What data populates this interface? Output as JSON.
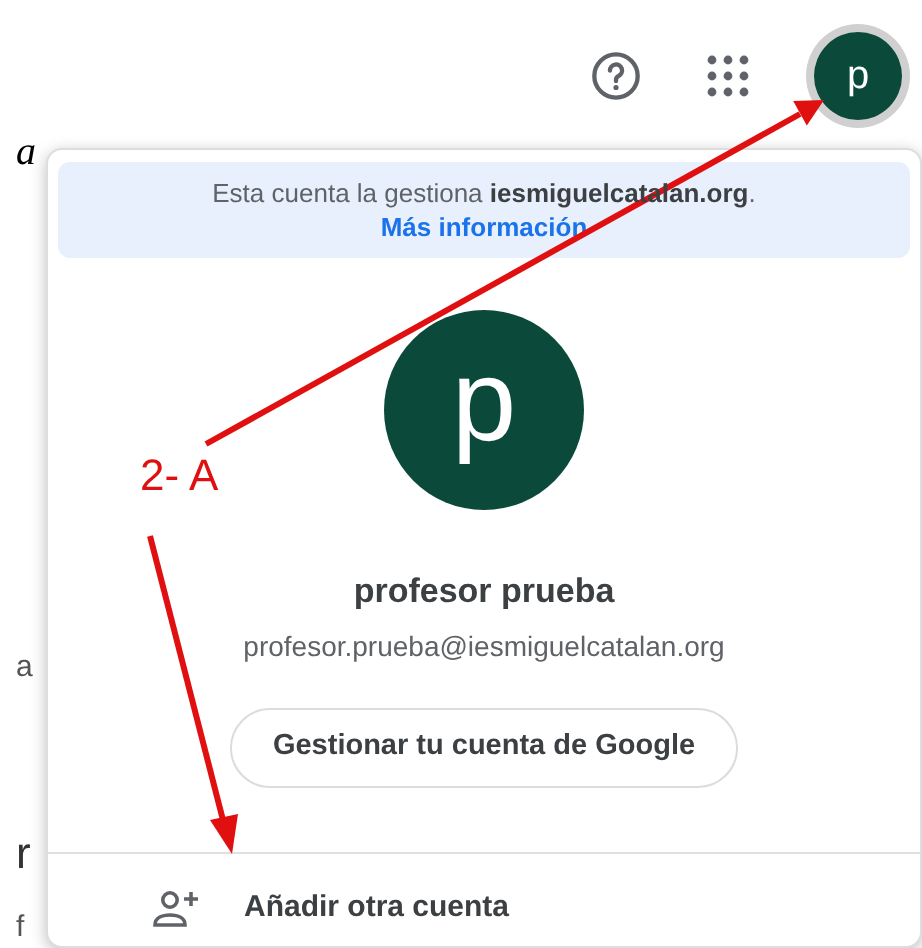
{
  "toolbar": {
    "avatar_letter": "p"
  },
  "background_fragments": [
    {
      "kind": "serif",
      "text": "a"
    },
    {
      "kind": "sans",
      "text": "a"
    },
    {
      "kind": "large",
      "text": "r"
    },
    {
      "kind": "sans",
      "text": "f"
    }
  ],
  "account_menu": {
    "notice": "Esta cuenta la gestiona **iesmiguelcatalan.org**.",
    "notice_link": "Más información",
    "avatar_letter": "p",
    "name": "profesor prueba",
    "email": "profesor.prueba@iesmiguelcatalan.org",
    "manage_button": "Gestionar tu cuenta de Google",
    "add_account": "Añadir otra cuenta"
  },
  "annotation": {
    "label": "2- A"
  }
}
